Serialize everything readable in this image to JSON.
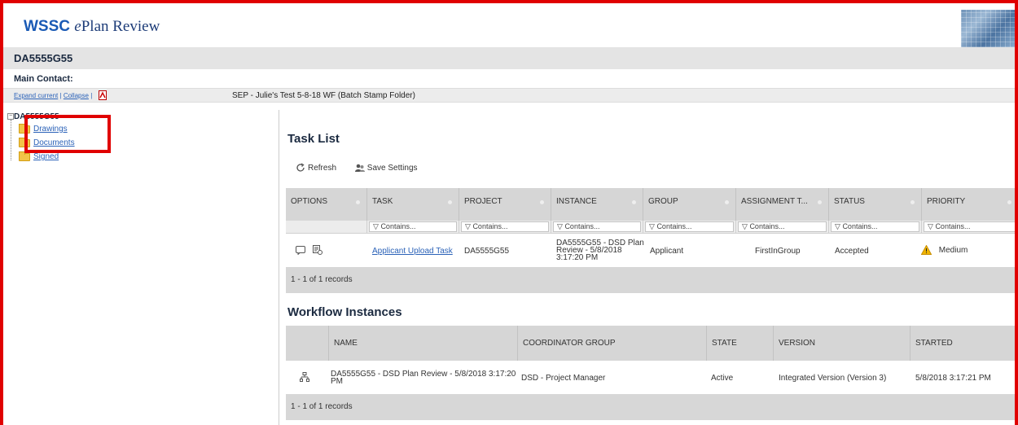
{
  "header": {
    "logo_wssc": "WSSC",
    "logo_e": "e",
    "logo_rest": "Plan Review"
  },
  "project_id": "DA5555G55",
  "main_contact_label": "Main Contact:",
  "subbar": {
    "expand_current": "Expand current",
    "separator": "|",
    "collapse": "Collapse",
    "separator2": "|",
    "folder_title": "SEP - Julie's Test 5-8-18 WF (Batch Stamp Folder)"
  },
  "tree": {
    "root": "DA5555G55",
    "items": [
      {
        "label": "Drawings"
      },
      {
        "label": "Documents"
      },
      {
        "label": "Signed"
      }
    ]
  },
  "task_list": {
    "title": "Task List",
    "toolbar": {
      "refresh": "Refresh",
      "save_settings": "Save Settings"
    },
    "columns": [
      "OPTIONS",
      "TASK",
      "PROJECT",
      "INSTANCE",
      "GROUP",
      "ASSIGNMENT T...",
      "STATUS",
      "PRIORITY"
    ],
    "filter_placeholder": "Contains...",
    "rows": [
      {
        "task": "Applicant Upload Task",
        "project": "DA5555G55",
        "instance_l1": "DA5555G55 - DSD Plan",
        "instance_l2": "Review - 5/8/2018",
        "instance_l3": "3:17:20 PM",
        "group": "Applicant",
        "assignment": "FirstInGroup",
        "status": "Accepted",
        "priority": "Medium"
      }
    ],
    "footer": "1 - 1 of 1 records"
  },
  "workflow": {
    "title": "Workflow Instances",
    "columns": [
      "NAME",
      "COORDINATOR GROUP",
      "STATE",
      "VERSION",
      "STARTED"
    ],
    "rows": [
      {
        "name_l1": "DA5555G55 - DSD Plan Review - 5/8/2018 3:17:20",
        "name_l2": "PM",
        "coordinator": "DSD - Project Manager",
        "state": "Active",
        "version": "Integrated Version (Version 3)",
        "started": "5/8/2018 3:17:21 PM"
      }
    ],
    "footer": "1 - 1 of 1 records"
  },
  "colors": {
    "accent": "#2b62b8",
    "highlight": "#e00000",
    "priority_warning": "#f0b400"
  }
}
